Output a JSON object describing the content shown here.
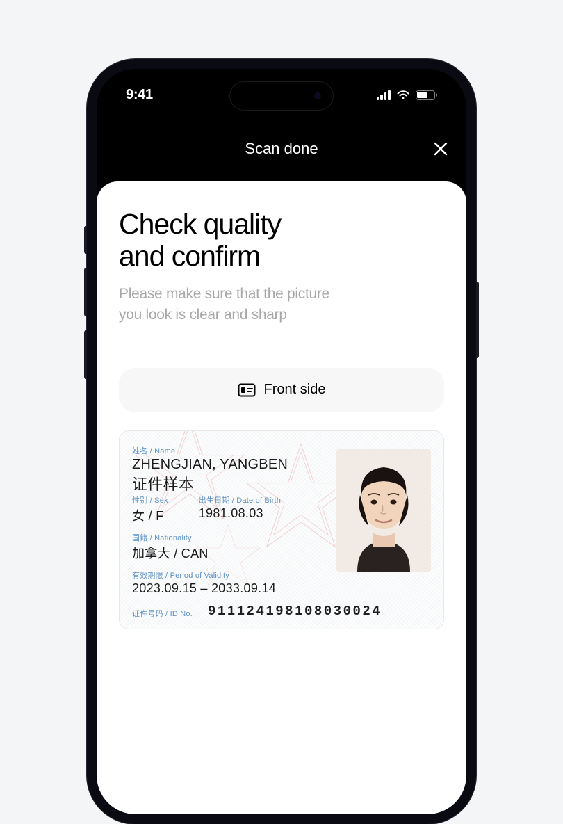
{
  "status_bar": {
    "time": "9:41"
  },
  "header": {
    "title": "Scan done"
  },
  "content": {
    "heading_line1": "Check quality",
    "heading_line2": "and confirm",
    "subtext_line1": "Please make sure that the picture",
    "subtext_line2": "you look is clear and sharp",
    "side_label": "Front side"
  },
  "id_card": {
    "name_label": "姓名 / Name",
    "name_value": "ZHENGJIAN, YANGBEN",
    "name_cn": "证件样本",
    "sex_label": "性别 / Sex",
    "sex_value": "女 / F",
    "dob_label": "出生日期 / Date of Birth",
    "dob_value": "1981.08.03",
    "nationality_label": "国籍 / Nationality",
    "nationality_value": "加拿大 / CAN",
    "validity_label": "有效期限 / Period of Validity",
    "validity_value": "2023.09.15 – 2033.09.14",
    "id_label": "证件号码 / ID No.",
    "id_value": "911124198108030024"
  }
}
